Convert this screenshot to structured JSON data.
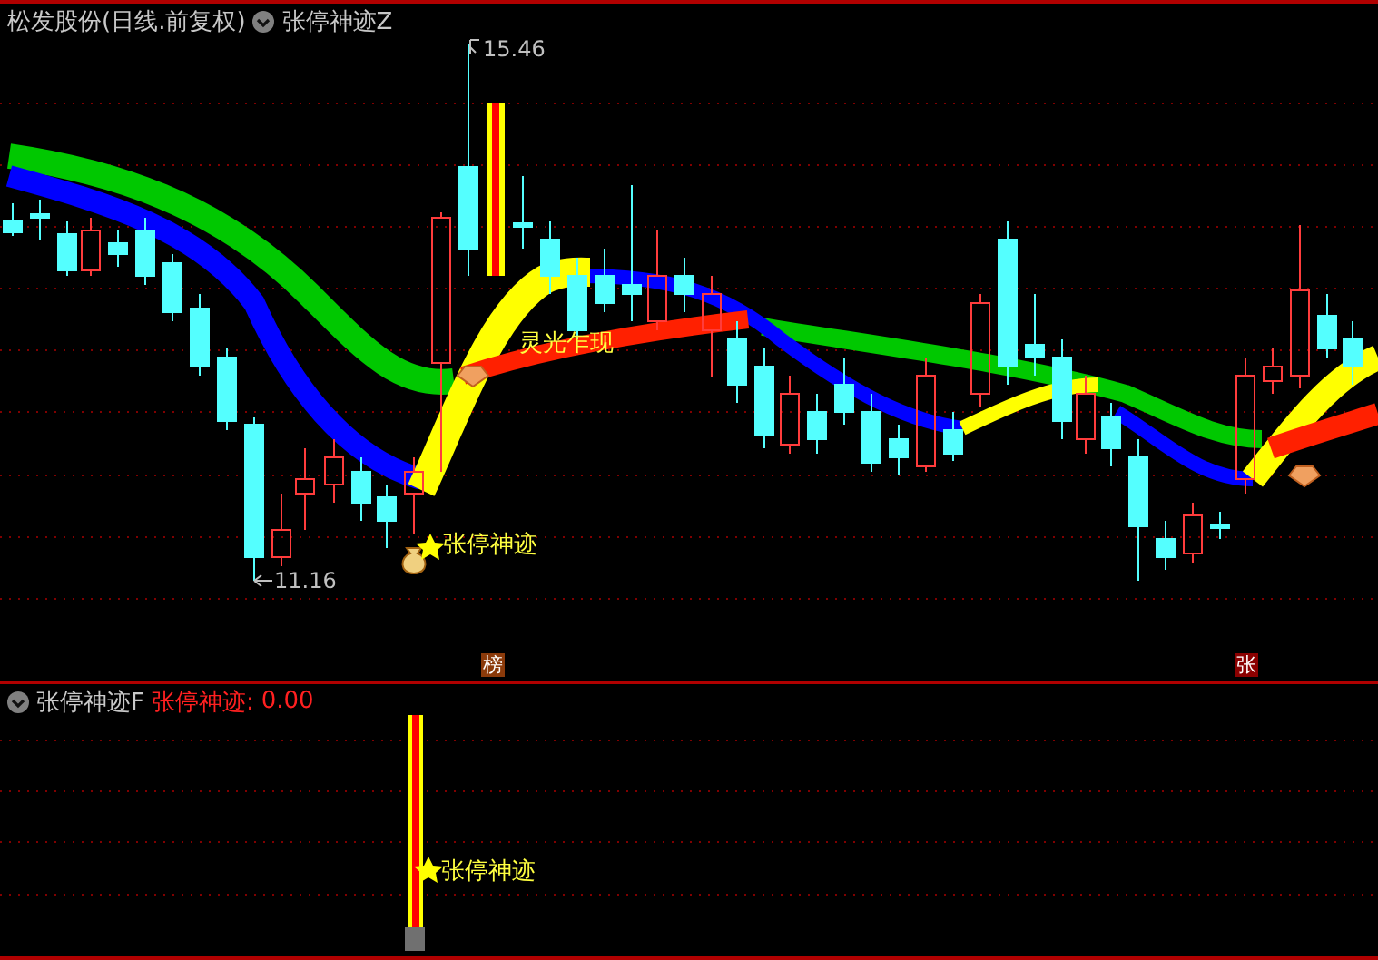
{
  "main_panel": {
    "stock_title": "松发股份(日线.前复权)",
    "indicator": "张停神迹Z",
    "high_label": "15.46",
    "low_label": "11.16",
    "signal_label": "灵光乍现",
    "marker_label": "张停神迹",
    "badges": [
      {
        "text": "榜",
        "color": "#8b3a0a"
      },
      {
        "text": "张",
        "color": "#8b0000"
      }
    ]
  },
  "sub_panel": {
    "indicator": "张停神迹F",
    "readout_name": "张停神迹:",
    "readout_value": "0.00",
    "marker_label": "张停神迹"
  }
}
